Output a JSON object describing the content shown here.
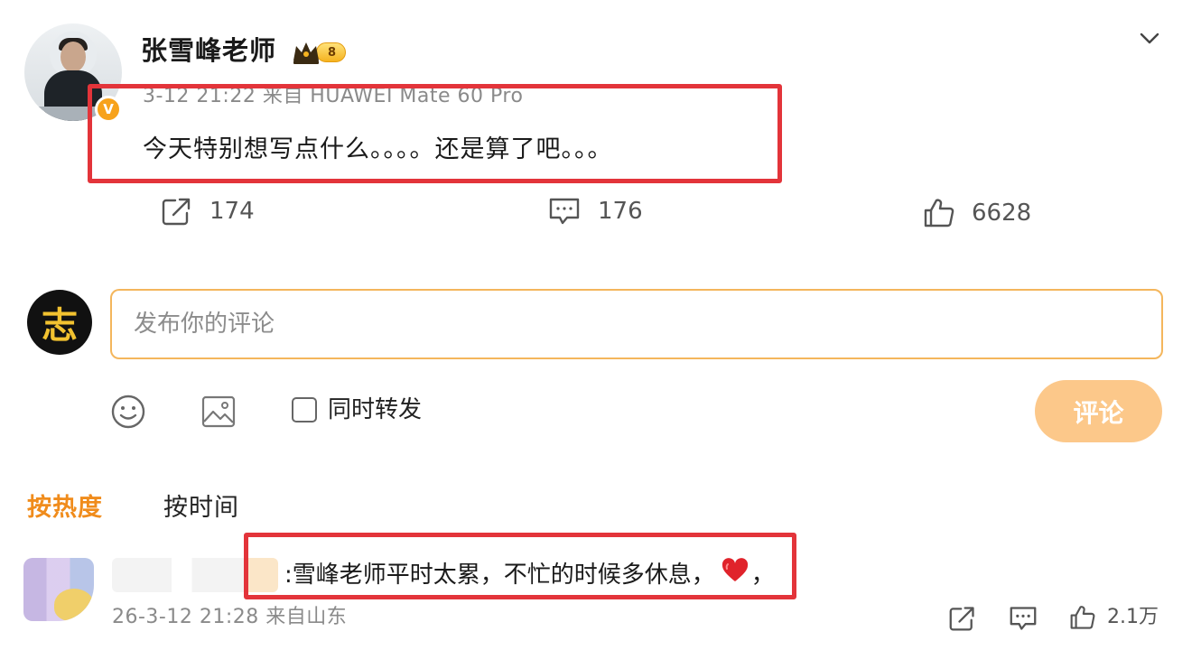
{
  "post": {
    "author_name": "张雪峰老师",
    "vip_level": "8",
    "meta": "3-12 21:22 来自 HUAWEI Mate 60 Pro",
    "text": "今天特别想写点什么。。。。还是算了吧。。。",
    "verified_mark": "V"
  },
  "actions": {
    "share_count": "174",
    "comment_count": "176",
    "like_count": "6628"
  },
  "composer": {
    "avatar_char": "志",
    "placeholder": "发布你的评论",
    "repost_label": "同时转发",
    "submit_label": "评论"
  },
  "sort": {
    "hot_label": "按热度",
    "time_label": "按时间"
  },
  "comment": {
    "text": ":雪峰老师平时太累，不忙的时候多休息，",
    "text_tail": "，",
    "meta": "26-3-12 21:28 来自山东",
    "like_count": "2.1万"
  },
  "colors": {
    "accent_orange": "#f08c1c",
    "highlight_red": "#e3343a",
    "submit_disabled": "#fcc88a",
    "input_border": "#f4b65c"
  }
}
